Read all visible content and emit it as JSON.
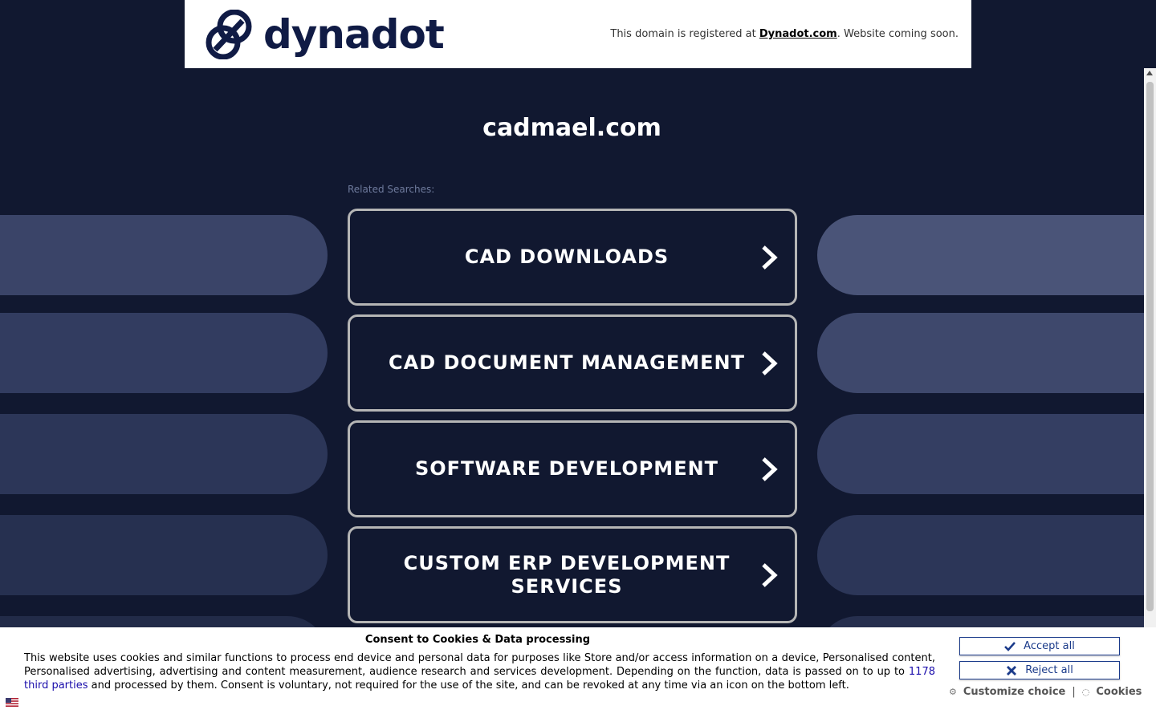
{
  "header": {
    "logo_text": "dynadot",
    "message_prefix": "This domain is registered at ",
    "message_link": "Dynadot.com",
    "message_suffix": ". Website coming soon."
  },
  "main": {
    "domain": "cadmael.com",
    "related_label": "Related Searches:",
    "searches": [
      {
        "label": "CAD DOWNLOADS"
      },
      {
        "label": "CAD DOCUMENT MANAGEMENT"
      },
      {
        "label": "SOFTWARE DEVELOPMENT"
      },
      {
        "label": "CUSTOM ERP DEVELOPMENT SERVICES"
      }
    ]
  },
  "cookie": {
    "title": "Consent to Cookies & Data processing",
    "text_part1": "This website uses cookies and similar functions to process end device and personal data for purposes like Store and/or access information on a device, Personalised content, Personalised advertising, advertising and content measurement, audience research and services development. Depending on the function, data is passed on to up to ",
    "third_parties_link": "1178 third parties",
    "text_part2": " and processed by them. Consent is voluntary, not required for the use of the site, and can be revoked at any time via an icon on the bottom left.",
    "accept_label": "Accept all",
    "reject_label": "Reject all",
    "customize_label": "Customize choice",
    "separator": "|",
    "cookies_label": "Cookies"
  },
  "colors": {
    "background": "#111830",
    "brand": "#101b45",
    "button_border": "#b5b5b5",
    "cookie_button": "#1a3a8a"
  }
}
